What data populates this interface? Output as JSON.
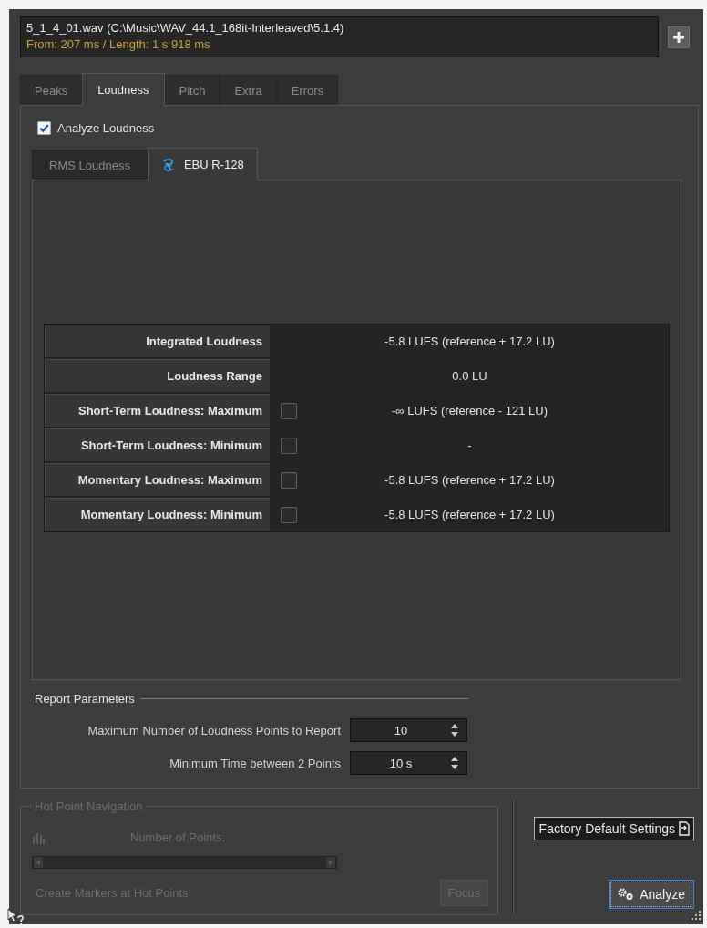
{
  "file": {
    "path": "5_1_4_01.wav (C:\\Music\\WAV_44.1_168it-Interleaved\\5.1.4)",
    "range": "From: 207 ms / Length: 1 s 918 ms"
  },
  "tabs": [
    {
      "label": "Peaks",
      "selected": false
    },
    {
      "label": "Loudness",
      "selected": true
    },
    {
      "label": "Pitch",
      "selected": false
    },
    {
      "label": "Extra",
      "selected": false
    },
    {
      "label": "Errors",
      "selected": false
    }
  ],
  "analyze_loudness": {
    "label": "Analyze Loudness",
    "checked": true
  },
  "subtabs": [
    {
      "label": "RMS Loudness",
      "selected": false,
      "icon": false
    },
    {
      "label": "EBU R-128",
      "selected": true,
      "icon": true
    }
  ],
  "results": [
    {
      "kind": "value",
      "label": "Integrated Loudness",
      "value": "-5.8 LUFS (reference + 17.2 LU)"
    },
    {
      "kind": "value",
      "label": "Loudness Range",
      "value": "0.0 LU"
    },
    {
      "kind": "check",
      "label": "Short-Term Loudness: Maximum",
      "checked": false,
      "value": "-∞ LUFS (reference - 121 LU)"
    },
    {
      "kind": "check",
      "label": "Short-Term Loudness: Minimum",
      "checked": false,
      "value": "-"
    },
    {
      "kind": "check",
      "label": "Momentary Loudness: Maximum",
      "checked": false,
      "value": "-5.8 LUFS (reference + 17.2 LU)"
    },
    {
      "kind": "check",
      "label": "Momentary Loudness: Minimum",
      "checked": false,
      "value": "-5.8 LUFS (reference + 17.2 LU)"
    }
  ],
  "report_parameters": {
    "title": "Report Parameters",
    "fields": [
      {
        "label": "Maximum Number of Loudness Points to Report",
        "value": "10"
      },
      {
        "label": "Minimum Time between 2 Points",
        "value": "10 s"
      }
    ]
  },
  "hot_point_navigation": {
    "title": "Hot Point Navigation",
    "disabled": true,
    "points_label": "Number of Points:",
    "markers_label": "Create Markers at Hot Points",
    "focus_button": "Focus"
  },
  "buttons": {
    "factory_default": "Factory Default Settings",
    "analyze": "Analyze"
  }
}
